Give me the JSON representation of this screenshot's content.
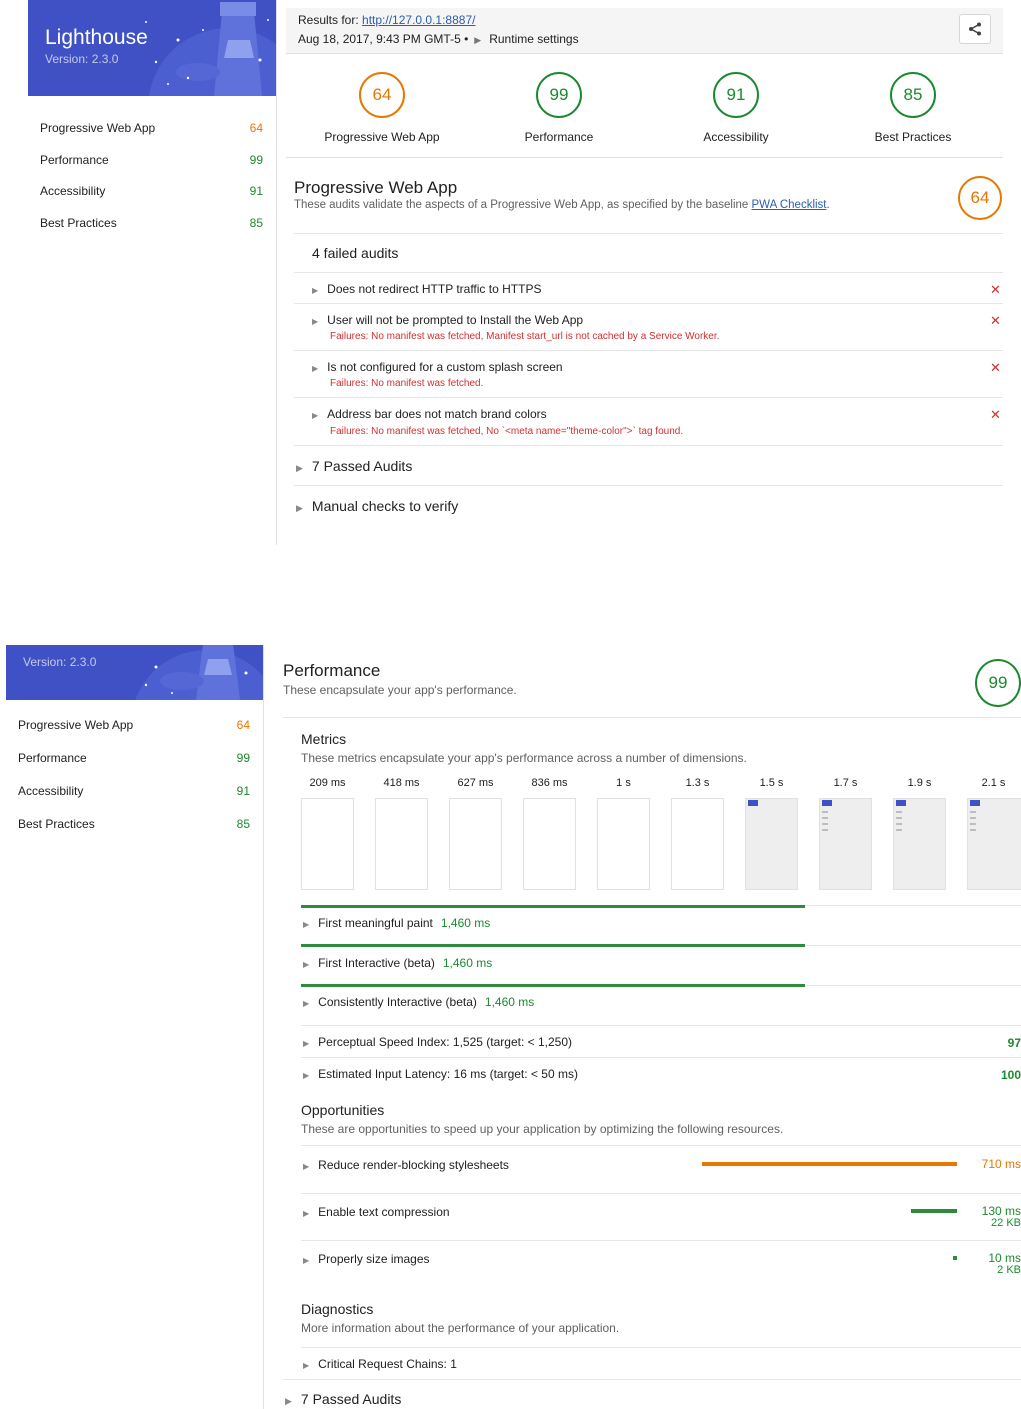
{
  "app": {
    "name": "Lighthouse",
    "version": "Version: 2.3.0"
  },
  "colors": {
    "banner": "#3f51c5",
    "pass": "#1b8a2e",
    "average": "#e67700",
    "fail": "#d32f2f"
  },
  "header": {
    "results_label": "Results for:",
    "url": "http://127.0.0.1:8887/",
    "date": "Aug 18, 2017, 9:43 PM GMT-5 •",
    "runtime_settings": "Runtime settings",
    "share_icon": "share-icon"
  },
  "sidebar": {
    "items": [
      {
        "label": "Progressive Web App",
        "score": "64"
      },
      {
        "label": "Performance",
        "score": "99"
      },
      {
        "label": "Accessibility",
        "score": "91"
      },
      {
        "label": "Best Practices",
        "score": "85"
      }
    ]
  },
  "gauges": [
    {
      "label": "Progressive Web App",
      "score": "64"
    },
    {
      "label": "Performance",
      "score": "99"
    },
    {
      "label": "Accessibility",
      "score": "91"
    },
    {
      "label": "Best Practices",
      "score": "85"
    }
  ],
  "pwa": {
    "title": "Progressive Web App",
    "description": "These audits validate the aspects of a Progressive Web App, as specified by the baseline",
    "link": "PWA Checklist",
    "score": "64",
    "failed_title": "4 failed audits",
    "failed": [
      {
        "title": "Does not redirect HTTP traffic to HTTPS",
        "detail": ""
      },
      {
        "title": "User will not be prompted to Install the Web App",
        "detail": "Failures: No manifest was fetched, Manifest start_url is not cached by a Service Worker."
      },
      {
        "title": "Is not configured for a custom splash screen",
        "detail": "Failures: No manifest was fetched."
      },
      {
        "title": "Address bar does not match brand colors",
        "detail": "Failures: No manifest was fetched, No `<meta name=\"theme-color\">` tag found."
      }
    ],
    "fail_mark": "✕",
    "passed": "7 Passed Audits",
    "manual": "Manual checks to verify"
  },
  "perf": {
    "title": "Performance",
    "description": "These encapsulate your app's performance.",
    "score": "99",
    "metrics_title": "Metrics",
    "metrics_desc": "These metrics encapsulate your app's performance across a number of dimensions.",
    "filmstrip": [
      "209 ms",
      "418 ms",
      "627 ms",
      "836 ms",
      "1 s",
      "1.3 s",
      "1.5 s",
      "1.7 s",
      "1.9 s",
      "2.1 s"
    ],
    "metrics": [
      {
        "label": "First meaningful paint",
        "value": "1,460 ms"
      },
      {
        "label": "First Interactive (beta)",
        "value": "1,460 ms"
      },
      {
        "label": "Consistently Interactive (beta)",
        "value": "1,460 ms"
      }
    ],
    "scored": [
      {
        "label": "Perceptual Speed Index: 1,525 (target: < 1,250)",
        "score": "97"
      },
      {
        "label": "Estimated Input Latency: 16 ms (target: < 50 ms)",
        "score": "100"
      }
    ],
    "opp_title": "Opportunities",
    "opp_desc": "These are opportunities to speed up your application by optimizing the following resources.",
    "opportunities": [
      {
        "label": "Reduce render-blocking stylesheets",
        "time": "710 ms",
        "size": "",
        "fraction": 1.0
      },
      {
        "label": "Enable text compression",
        "time": "130 ms",
        "size": "22 KB",
        "fraction": 0.18
      },
      {
        "label": "Properly size images",
        "time": "10 ms",
        "size": "2 KB",
        "fraction": 0.014
      }
    ],
    "diag_title": "Diagnostics",
    "diag_desc": "More information about the performance of your application.",
    "diagnostics": [
      "Critical Request Chains: 1"
    ],
    "passed": "7 Passed Audits"
  }
}
